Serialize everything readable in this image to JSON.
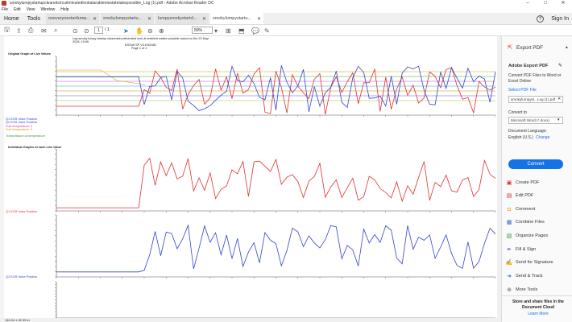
{
  "window": {
    "title": "smokylumpystartupclearedcircuitminutedlookatarabientestatetakepossible_Log (1).pdf - Adobe Acrobat Reader DC"
  },
  "menu": [
    "File",
    "Edit",
    "View",
    "Window",
    "Help"
  ],
  "tabs": {
    "home": "Home",
    "tools": "Tools",
    "docs": [
      "oneverynextartlump...",
      "smokylumpystartu...",
      "lumpysmokystartcl...",
      "smokylumpystartu..."
    ],
    "help": "?",
    "signin": "Sign In"
  },
  "toolbar": {
    "page_current": "1",
    "page_total": "/ 1",
    "zoom": "50%"
  },
  "pdf": {
    "header1": "Log smoky lumpy startup clearedcircuitminuted look at arabient estate possible saved on the 20 May",
    "header2": "2018, 19:06",
    "header3": "EDSoft SP V3.6 B2481",
    "header4": "Page 1 of 1",
    "section1": "Original Graph of Live Values",
    "legend": [
      "Q1 EGR Valve Position",
      "Q2 EGR Valve Position",
      "Fuel temperature: 0",
      "Fuel temperature: 4",
      "Transmission oil temperature"
    ],
    "section2": "Individual Graphs of each Live Value",
    "red_label": "Q1 EGR Valve Position",
    "blue_label": "Q2 EGR Valve Position"
  },
  "status": {
    "size": "146.04 x 40.35 in"
  },
  "rightpanel": {
    "export_header": "Export PDF",
    "adobe_export": "Adobe Export PDF",
    "desc": "Convert PDF Files to Word or Excel Online",
    "select_file": "Select PDF File",
    "file_name": "smokylumpyst...Log (1).pdf",
    "convert_to": "Convert to",
    "format": "Microsoft Word (*.docx)",
    "lang_label": "Document Language:",
    "lang_value": "English (U.S.)",
    "change": "Change",
    "convert_btn": "Convert",
    "tools": [
      "Create PDF",
      "Edit PDF",
      "Comment",
      "Combine Files",
      "Organize Pages",
      "Fill & Sign",
      "Send for Signature",
      "Send & Track",
      "More Tools"
    ],
    "store": "Store and share files in the Document Cloud",
    "learn": "Learn More"
  },
  "colors": {
    "accent": "#1473e6",
    "red_series": "#e03030",
    "blue_series": "#3344cc",
    "pdf_icon": "#d93025"
  }
}
